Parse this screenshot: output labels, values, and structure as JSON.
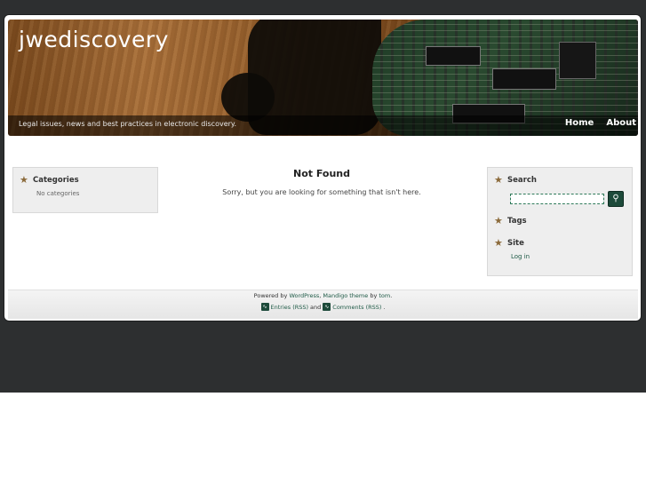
{
  "header": {
    "site_title": "jwediscovery",
    "tagline": "Legal issues, news and best practices in electronic discovery.",
    "nav": [
      "Home",
      "About"
    ]
  },
  "sidebar_left": {
    "categories_title": "Categories",
    "categories_empty": "No categories"
  },
  "main": {
    "title": "Not Found",
    "message": "Sorry, but you are looking for something that isn't here."
  },
  "sidebar_right": {
    "search_title": "Search",
    "search_value": "",
    "tags_title": "Tags",
    "site_title": "Site",
    "login_label": "Log in"
  },
  "footer": {
    "powered_prefix": "Powered by",
    "wordpress": "WordPress",
    "comma": ",",
    "theme": "Mandigo theme",
    "by": "by",
    "author": "tom",
    "period": ".",
    "entries_rss": "Entries (RSS)",
    "and": "and",
    "comments_rss": "Comments (RSS)",
    "end": "."
  },
  "icons": {
    "widget_icon": "star-icon",
    "search_button_icon": "magnifier-icon",
    "rss_icon": "rss-icon"
  },
  "colors": {
    "background": "#2d2f30",
    "accent": "#1d4a3a",
    "link": "#1e5a46"
  }
}
